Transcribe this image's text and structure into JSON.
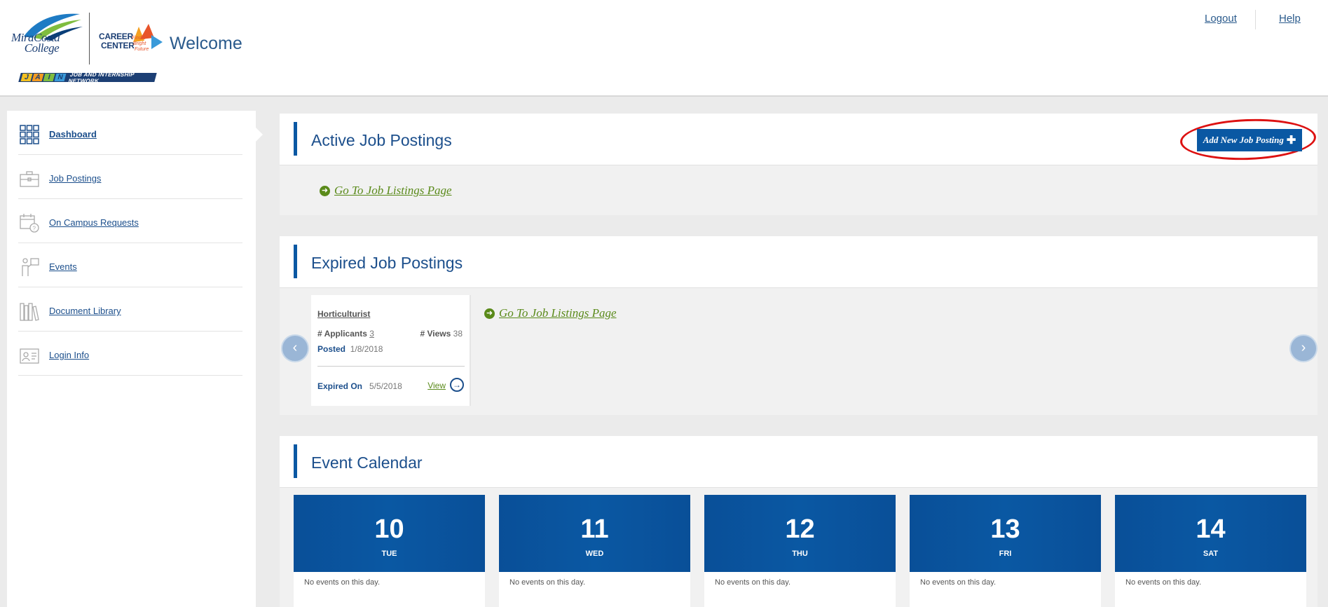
{
  "header": {
    "logo_college": "MiraCosta College",
    "logo_career": "CAREER CENTER",
    "logo_tagline": "Find a Bright Future",
    "welcome": "Welcome",
    "jain_letters": [
      "J",
      "A",
      "I",
      "N"
    ],
    "jain_sub": "JOB AND INTERNSHIP NETWORK",
    "links": {
      "logout": "Logout",
      "help": "Help"
    }
  },
  "sidebar": {
    "items": [
      {
        "label": "Dashboard",
        "icon": "dashboard-grid-icon",
        "active": true
      },
      {
        "label": "Job Postings",
        "icon": "briefcase-icon"
      },
      {
        "label": "On Campus Requests",
        "icon": "calendar-question-icon"
      },
      {
        "label": "Events",
        "icon": "presenter-icon"
      },
      {
        "label": "Document Library",
        "icon": "books-icon"
      },
      {
        "label": "Login Info",
        "icon": "id-card-icon"
      }
    ]
  },
  "active_postings": {
    "title": "Active Job Postings",
    "add_button": "Add New Job Posting",
    "go_link": "Go To Job Listings Page"
  },
  "expired_postings": {
    "title": "Expired Job Postings",
    "go_link": "Go To Job Listings Page",
    "card": {
      "title": "Horticulturist",
      "applicants_label": "# Applicants",
      "applicants": "3",
      "views_label": "# Views",
      "views": "38",
      "posted_label": "Posted",
      "posted": "1/8/2018",
      "expired_label": "Expired On",
      "expired": "5/5/2018",
      "view": "View"
    }
  },
  "event_calendar": {
    "title": "Event Calendar",
    "days": [
      {
        "num": "10",
        "dow": "TUE",
        "text": "No events on this day."
      },
      {
        "num": "11",
        "dow": "WED",
        "text": "No events on this day."
      },
      {
        "num": "12",
        "dow": "THU",
        "text": "No events on this day."
      },
      {
        "num": "13",
        "dow": "FRI",
        "text": "No events on this day."
      },
      {
        "num": "14",
        "dow": "SAT",
        "text": "No events on this day."
      }
    ]
  },
  "colors": {
    "brand_blue": "#0a58a3",
    "link_green": "#5a8a1a",
    "highlight_red": "#dd1111"
  }
}
